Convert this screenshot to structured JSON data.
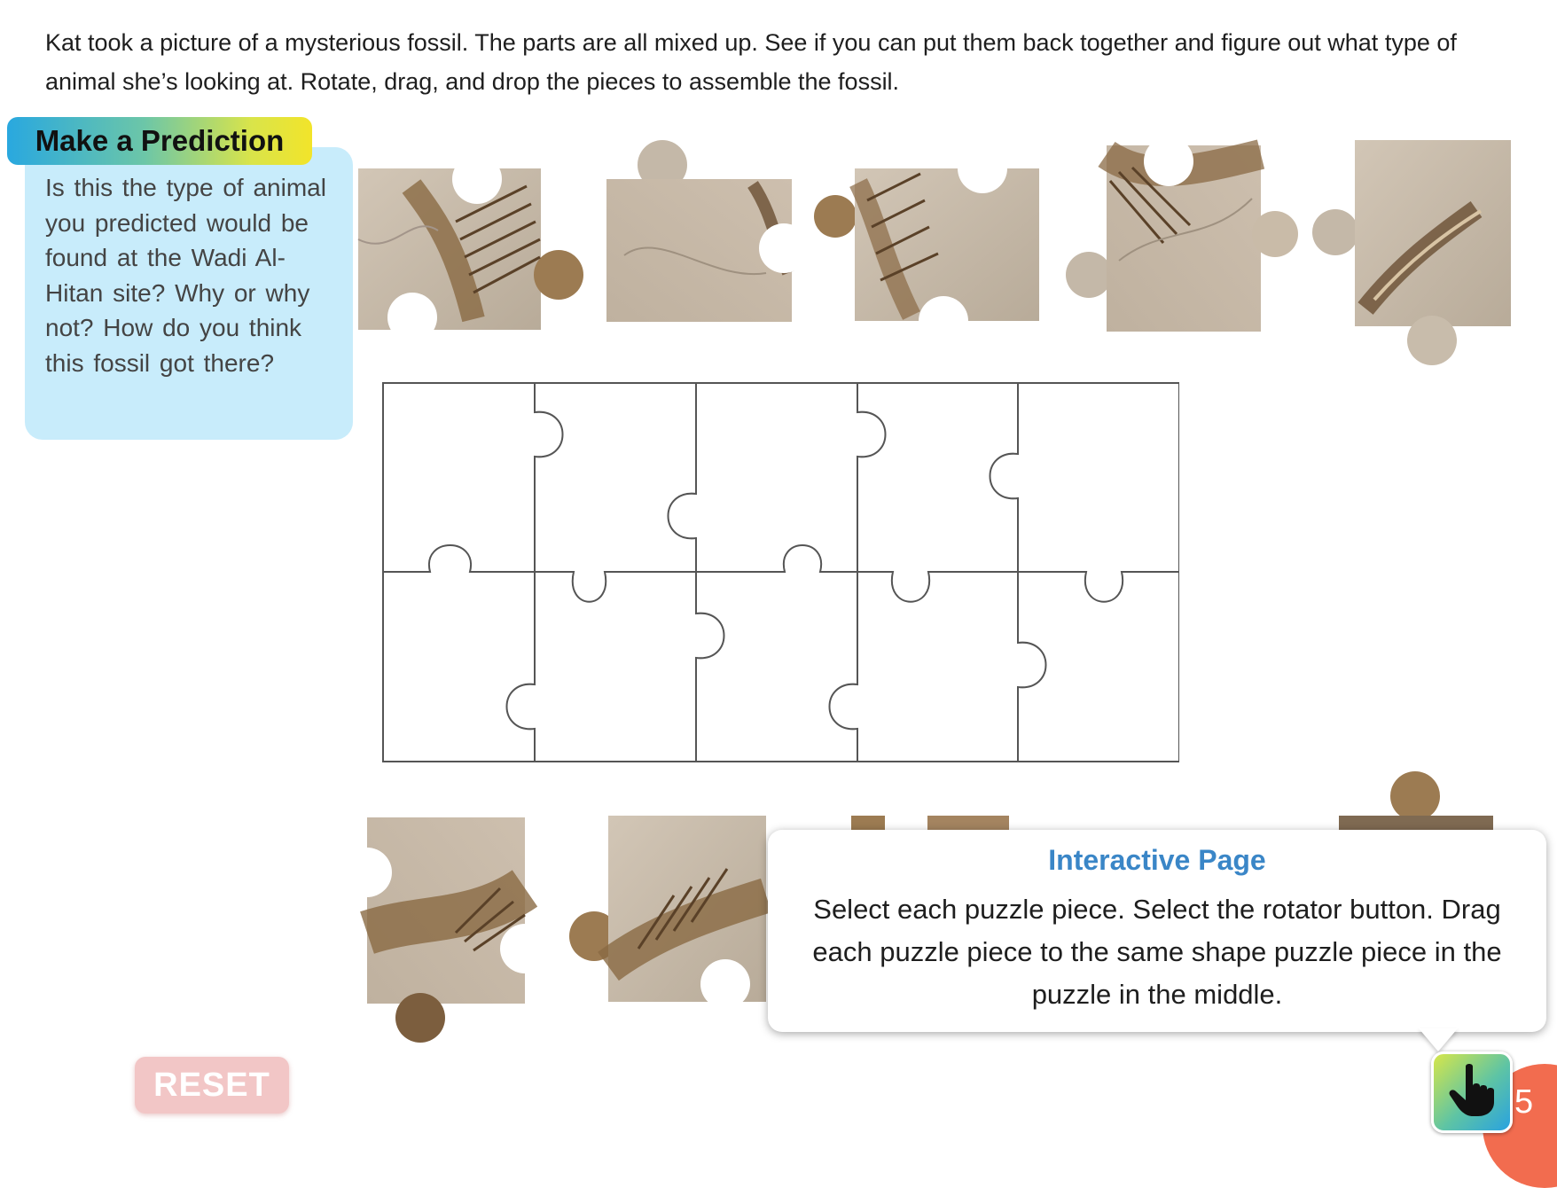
{
  "intro_text": "Kat took a picture of a mysterious fossil. The parts are all mixed up. See if you can put them back together and figure out what type of animal she’s looking at. Rotate, drag, and drop the pieces to assemble the fossil.",
  "prediction": {
    "tab_label": "Make a Prediction",
    "text": "Is this the type of animal you predicted would be found at the Wadi Al-Hitan site? Why or why not? How do you think this fossil got there?"
  },
  "popup": {
    "title": "Interactive Page",
    "body": "Select each puzzle piece. Select the rotator button. Drag each puzzle piece to the same shape puzzle piece in the puzzle in the middle."
  },
  "reset_label": "RESET",
  "page_number": "5",
  "colors": {
    "prediction_bg": "#c8ecfb",
    "popup_title": "#3a86c7",
    "reset_bg": "#f2c6c6",
    "page_corner": "#f26c4f",
    "stone": "#c9bdad",
    "fossil": "#8a6a44"
  },
  "icons": [
    "pointing-hand-icon"
  ],
  "puzzle": {
    "rows": 2,
    "columns": 5
  }
}
